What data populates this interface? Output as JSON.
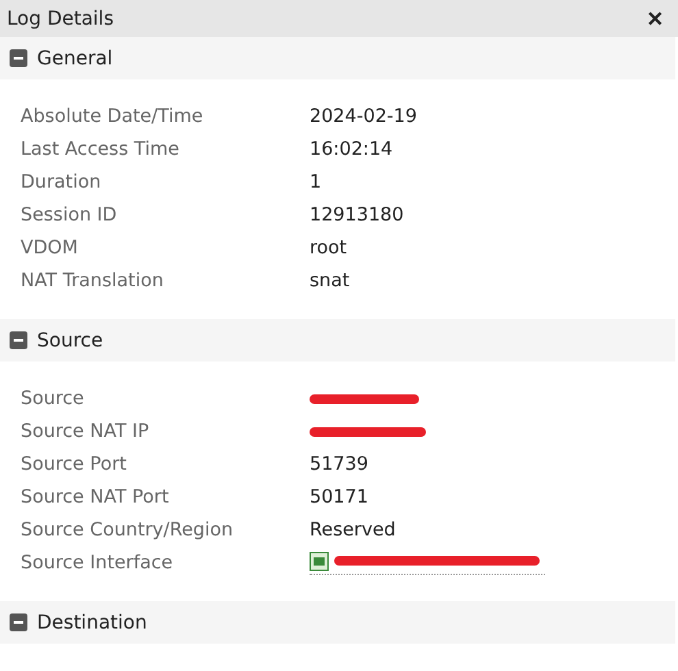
{
  "window": {
    "title": "Log Details",
    "close": "✕"
  },
  "sections": [
    {
      "title": "General",
      "expanded": true,
      "rows": [
        {
          "label": "Absolute Date/Time",
          "kind": "text",
          "value": "2024-02-19"
        },
        {
          "label": "Last Access Time",
          "kind": "text",
          "value": "16:02:14"
        },
        {
          "label": "Duration",
          "kind": "text",
          "value": "1"
        },
        {
          "label": "Session ID",
          "kind": "text",
          "value": "12913180"
        },
        {
          "label": "VDOM",
          "kind": "text",
          "value": "root"
        },
        {
          "label": "NAT Translation",
          "kind": "text",
          "value": "snat"
        }
      ]
    },
    {
      "title": "Source",
      "expanded": true,
      "rows": [
        {
          "label": "Source",
          "kind": "redacted"
        },
        {
          "label": "Source NAT IP",
          "kind": "redacted"
        },
        {
          "label": "Source Port",
          "kind": "text",
          "value": "51739"
        },
        {
          "label": "Source NAT Port",
          "kind": "text",
          "value": "50171"
        },
        {
          "label": "Source Country/Region",
          "kind": "text",
          "value": "Reserved"
        },
        {
          "label": "Source Interface",
          "kind": "interface-redacted"
        }
      ]
    },
    {
      "title": "Destination",
      "expanded": true
    }
  ]
}
